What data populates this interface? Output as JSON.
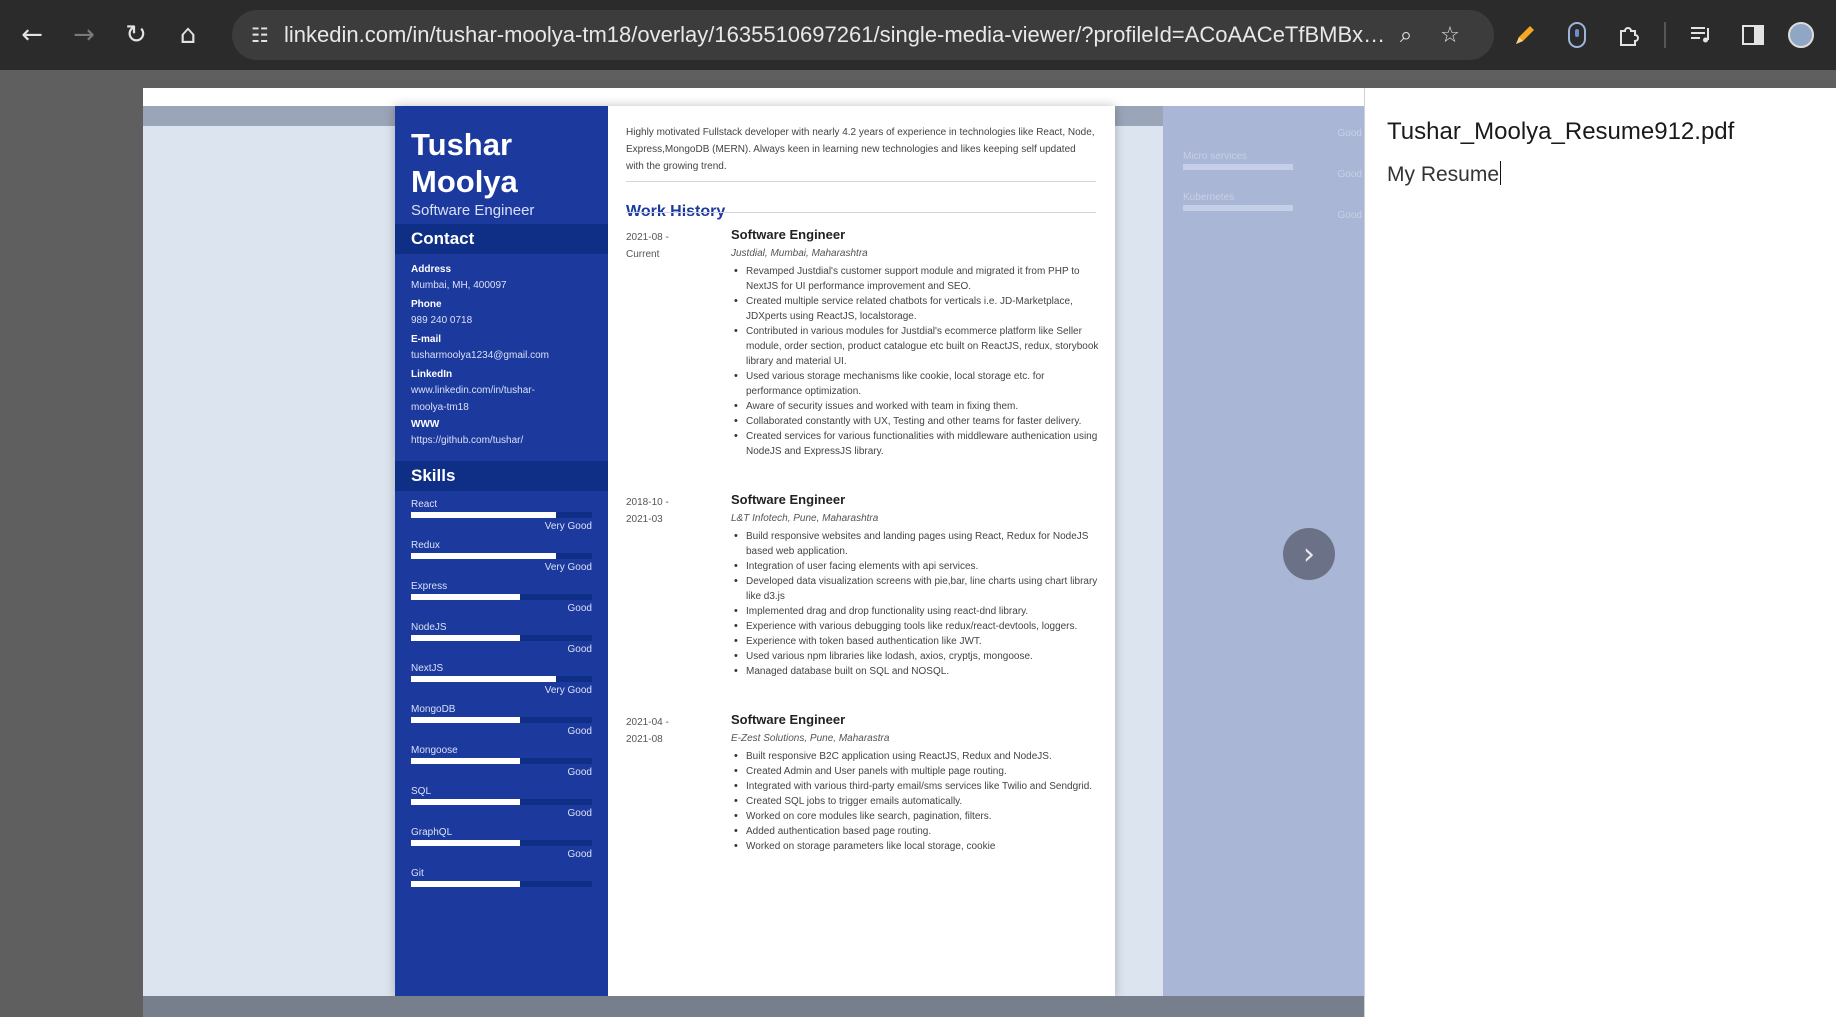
{
  "browser": {
    "url": "linkedin.com/in/tushar-moolya-tm18/overlay/1635510697261/single-media-viewer/?profileId=ACoAACeTfBMBxQQ1..."
  },
  "ghost_panel": {
    "rows": [
      "Micro services",
      "Kubernetes"
    ],
    "levels": [
      "Good",
      "Good",
      "Good"
    ]
  },
  "resume": {
    "name_line1": "Tushar",
    "name_line2": "Moolya",
    "role": "Software Engineer",
    "contact_heading": "Contact",
    "contact": [
      {
        "label": "Address",
        "value": "Mumbai, MH, 400097"
      },
      {
        "label": "Phone",
        "value": "989 240 0718"
      },
      {
        "label": "E-mail",
        "value": "tusharmoolya1234@gmail.com"
      },
      {
        "label": "LinkedIn",
        "value": "www.linkedin.com/in/tushar-moolya-tm18"
      },
      {
        "label": "WWW",
        "value": "https://github.com/tushar/"
      }
    ],
    "skills_heading": "Skills",
    "skills": [
      {
        "name": "React",
        "level": "Very Good",
        "fill": 0.8
      },
      {
        "name": "Redux",
        "level": "Very Good",
        "fill": 0.8
      },
      {
        "name": "Express",
        "level": "Good",
        "fill": 0.6
      },
      {
        "name": "NodeJS",
        "level": "Good",
        "fill": 0.6
      },
      {
        "name": "NextJS",
        "level": "Very Good",
        "fill": 0.8
      },
      {
        "name": "MongoDB",
        "level": "Good",
        "fill": 0.6
      },
      {
        "name": "Mongoose",
        "level": "Good",
        "fill": 0.6
      },
      {
        "name": "SQL",
        "level": "Good",
        "fill": 0.6
      },
      {
        "name": "GraphQL",
        "level": "Good",
        "fill": 0.6
      },
      {
        "name": "Git",
        "level": "",
        "fill": 0.6
      }
    ],
    "summary": "Highly motivated Fullstack developer with nearly 4.2 years of experience in technologies like React, Node, Express,MongoDB (MERN). Always keen in learning new technologies and likes keeping self updated with the growing trend.",
    "work_history_heading": "Work History",
    "jobs": [
      {
        "dates_start": "2021-08 -",
        "dates_end": "Current",
        "title": "Software Engineer",
        "company": "Justdial, Mumbai, Maharashtra",
        "bullets": [
          "Revamped Justdial's customer support module and migrated it from PHP to NextJS for UI performance improvement and SEO.",
          "Created multiple service related chatbots for verticals i.e. JD-Marketplace, JDXperts using ReactJS, localstorage.",
          "Contributed in various modules for Justdial's ecommerce platform like Seller module, order section, product catalogue etc built on ReactJS, redux, storybook library and material UI.",
          "Used various storage mechanisms like cookie, local storage etc. for performance optimization.",
          "Aware of security issues and worked with team in fixing them.",
          "Collaborated constantly with UX, Testing and other teams for faster delivery.",
          "Created services for various functionalities with middleware authenication using NodeJS and ExpressJS library."
        ]
      },
      {
        "dates_start": "2018-10 -",
        "dates_end": "2021-03",
        "title": "Software Engineer",
        "company": "L&T Infotech, Pune, Maharashtra",
        "bullets": [
          "Build responsive websites and landing pages using React, Redux for NodeJS based web application.",
          "Integration of user facing elements with api services.",
          "Developed data visualization screens with pie,bar, line charts using chart library like d3.js",
          "Implemented drag and drop functionality using react-dnd library.",
          "Experience with various debugging tools like redux/react-devtools, loggers.",
          "Experience with token based authentication like JWT.",
          "Used various npm libraries like lodash, axios, cryptjs, mongoose.",
          "Managed database built on SQL and NOSQL."
        ]
      },
      {
        "dates_start": "2021-04 -",
        "dates_end": "2021-08",
        "title": "Software Engineer",
        "company": "E-Zest Solutions, Pune, Maharastra",
        "bullets": [
          "Built responsive B2C application using ReactJS, Redux and NodeJS.",
          "Created Admin and User panels with multiple page routing.",
          "Integrated with various third-party email/sms services like Twilio and Sendgrid.",
          "Created SQL jobs to trigger emails automatically.",
          "Worked on core modules like search, pagination, filters.",
          "Added authentication based page routing.",
          "Worked on storage parameters like local storage, cookie"
        ]
      }
    ]
  },
  "details": {
    "file_title": "Tushar_Moolya_Resume912.pdf",
    "description": "My Resume"
  },
  "icons": {
    "back": "←",
    "forward": "→",
    "reload": "↻",
    "home": "⌂",
    "site_settings": "☷",
    "zoom": "⌕",
    "bookmark": "☆",
    "next": "›"
  }
}
